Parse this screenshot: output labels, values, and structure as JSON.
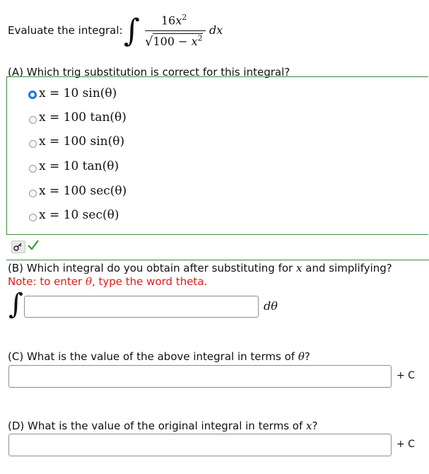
{
  "header": {
    "prompt": "Evaluate the integral:",
    "numerator": "16",
    "num_var": "x",
    "num_exp": "2",
    "denominator_const": "100",
    "denominator_op": "−",
    "denominator_var": "x",
    "denominator_exp": "2",
    "differential_d": "d",
    "differential_var": "x",
    "integral_sign": "∫",
    "sqrt_sign": "√"
  },
  "part_a": {
    "question": "(A) Which trig substitution is correct for this integral?",
    "selected_index": 0,
    "options": [
      "x = 10 sin(θ)",
      "x = 100 tan(θ)",
      "x = 100 sin(θ)",
      "x = 10 tan(θ)",
      "x = 100 sec(θ)",
      "x = 10 sec(θ)"
    ],
    "status": "correct"
  },
  "part_b": {
    "question_prefix": "(B) Which integral do you obtain after substituting for",
    "question_var": "x",
    "question_suffix": "and simplifying?",
    "note_prefix": "Note: to enter",
    "note_var": "θ",
    "note_suffix": ", type the word theta.",
    "integral_sign": "∫",
    "input_value": "",
    "differential": "dθ"
  },
  "part_c": {
    "question_prefix": "(C) What is the value of the above integral in terms of",
    "question_var": "θ",
    "question_suffix": "?",
    "input_value": "",
    "suffix": "+ C"
  },
  "part_d": {
    "question_prefix": "(D) What is the value of the original integral in terms of",
    "question_var": "x",
    "question_suffix": "?",
    "input_value": "",
    "suffix": "+ C"
  },
  "colors": {
    "accent": "#1a73e8",
    "correct": "#2e9e2e",
    "note": "#e11b1b",
    "section_border": "#3c8a3c"
  },
  "icons": [
    "key-icon",
    "check-icon"
  ]
}
